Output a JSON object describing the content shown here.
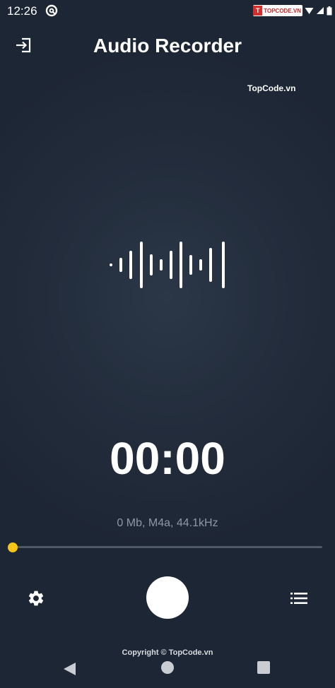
{
  "status_bar": {
    "time": "12:26",
    "app_icon": "at-circle-icon",
    "watermark_logo": "T",
    "watermark_text": "TOPCODE.VN"
  },
  "header": {
    "title": "Audio Recorder",
    "exit_icon": "exit-icon",
    "watermark": "TopCode.vn"
  },
  "recorder": {
    "timer": "00:00",
    "info": "0 Mb, M4a, 44.1kHz",
    "progress": 0,
    "waveform_icon": "audio-waveform-icon"
  },
  "controls": {
    "settings_icon": "gear-icon",
    "record_icon": "record-circle",
    "list_icon": "list-icon"
  },
  "footer": {
    "copyright": "Copyright © TopCode.vn"
  },
  "nav_bar": {
    "back_icon": "back-triangle-icon",
    "home_icon": "home-circle-icon",
    "recents_icon": "recents-square-icon"
  },
  "colors": {
    "background": "#1e2735",
    "accent": "#f5c518",
    "text_secondary": "#8f98a6"
  }
}
